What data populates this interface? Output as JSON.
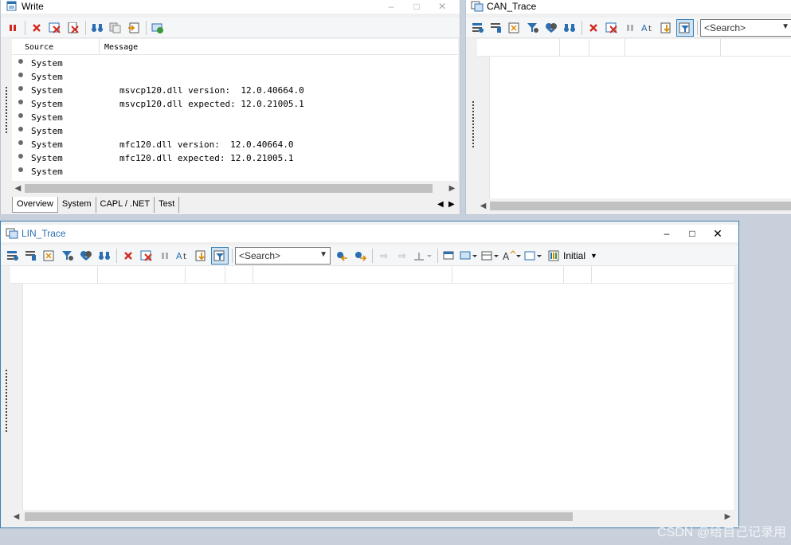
{
  "colors": {
    "desktop": "#c8d0dc",
    "window_border": "#9fb6cd",
    "active_border": "#3c7fb1",
    "icon_blue": "#2b6fb3",
    "icon_red": "#d12b1e"
  },
  "write_window": {
    "title": "Write",
    "window_buttons": [
      "–",
      "□",
      "✕"
    ],
    "toolbar_icons": [
      "pause-icon",
      "delete-icon",
      "clear-icon",
      "clear-all-icon",
      "find-icon",
      "copy-icon",
      "export-icon",
      "network-icon"
    ],
    "columns": [
      "Source",
      "Message"
    ],
    "rows": [
      {
        "source": "System",
        "message": ""
      },
      {
        "source": "System",
        "message": ""
      },
      {
        "source": "System",
        "message": "msvcp120.dll version:  12.0.40664.0"
      },
      {
        "source": "System",
        "message": "msvcp120.dll expected: 12.0.21005.1"
      },
      {
        "source": "System",
        "message": ""
      },
      {
        "source": "System",
        "message": ""
      },
      {
        "source": "System",
        "message": "mfc120.dll version:  12.0.40664.0"
      },
      {
        "source": "System",
        "message": "mfc120.dll expected: 12.0.21005.1"
      },
      {
        "source": "System",
        "message": ""
      }
    ],
    "tabs": [
      "Overview",
      "System",
      "CAPL / .NET",
      "Test"
    ],
    "active_tab": "Overview"
  },
  "can_window": {
    "title": "CAN_Trace",
    "search_placeholder": "<Search>"
  },
  "lin_window": {
    "title": "LIN_Trace",
    "window_buttons": [
      "–",
      "□",
      "✕"
    ],
    "search_placeholder": "<Search>",
    "initial_label": "Initial"
  },
  "watermark": "CSDN @给自己记录用"
}
